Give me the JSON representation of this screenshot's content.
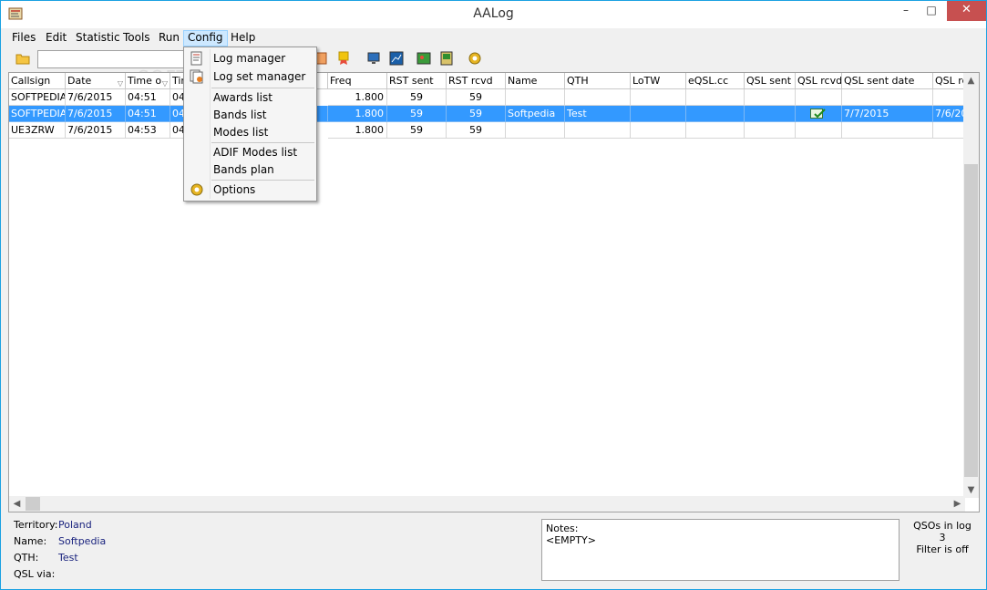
{
  "window": {
    "title": "AALog",
    "minimize": "–",
    "maximize": "□",
    "close": "✕"
  },
  "menu": [
    {
      "label": "Files",
      "key": "files"
    },
    {
      "label": "Edit",
      "key": "edit"
    },
    {
      "label": "Statistic",
      "key": "statistic"
    },
    {
      "label": "Tools",
      "key": "tools"
    },
    {
      "label": "Run",
      "key": "run"
    },
    {
      "label": "Config",
      "key": "config",
      "active": true
    },
    {
      "label": "Help",
      "key": "help"
    }
  ],
  "search": {
    "value": "",
    "placeholder": ""
  },
  "config_menu": {
    "items": [
      {
        "label": "Log manager",
        "icon": "log-manager-icon"
      },
      {
        "label": "Log set manager",
        "icon": "log-set-manager-icon"
      },
      {
        "label": "Awards list"
      },
      {
        "label": "Bands list"
      },
      {
        "label": "Modes list"
      },
      {
        "label": "ADIF Modes list"
      },
      {
        "label": "Bands plan"
      },
      {
        "label": "Options",
        "icon": "gear-icon"
      }
    ]
  },
  "grid": {
    "columns": [
      "Callsign",
      "Date",
      "Time o",
      "Tim",
      "Freq",
      "RST sent",
      "RST rcvd",
      "Name",
      "QTH",
      "LoTW",
      "eQSL.cc",
      "QSL sent",
      "QSL rcvd",
      "QSL sent date",
      "QSL rc"
    ],
    "rows": [
      {
        "callsign": "SOFTPEDIA",
        "date": "7/6/2015",
        "time_on": "04:51",
        "time_off": "04",
        "freq": "1.800",
        "rst_sent": "59",
        "rst_rcvd": "59",
        "name": "",
        "qth": "",
        "lotw": "",
        "eqsl": "",
        "qsl_sent": "",
        "qsl_rcvd": "",
        "qsl_sent_date": "",
        "qsl_rcvd_date": "",
        "selected": false
      },
      {
        "callsign": "SOFTPEDIA",
        "date": "7/6/2015",
        "time_on": "04:51",
        "time_off": "04",
        "freq": "1.800",
        "rst_sent": "59",
        "rst_rcvd": "59",
        "name": "Softpedia",
        "qth": "Test",
        "lotw": "",
        "eqsl": "",
        "qsl_sent": "",
        "qsl_rcvd": "check-icon",
        "qsl_sent_date": "7/7/2015",
        "qsl_rcvd_date": "7/6/20",
        "selected": true
      },
      {
        "callsign": "UE3ZRW",
        "date": "7/6/2015",
        "time_on": "04:53",
        "time_off": "04",
        "freq": "1.800",
        "rst_sent": "59",
        "rst_rcvd": "59",
        "name": "",
        "qth": "",
        "lotw": "",
        "eqsl": "",
        "qsl_sent": "",
        "qsl_rcvd": "",
        "qsl_sent_date": "",
        "qsl_rcvd_date": "",
        "selected": false
      }
    ]
  },
  "status": {
    "territory_label": "Territory:",
    "territory": "Poland",
    "name_label": "Name:",
    "name": "Softpedia",
    "qth_label": "QTH:",
    "qth": "Test",
    "qsl_via_label": "QSL via:",
    "qsl_via": "",
    "notes_label": "Notes:",
    "notes": "<EMPTY>",
    "qsos_label": "QSOs in log",
    "qsos_count": "3",
    "filter": "Filter is off"
  },
  "watermark": "SOFTPEDIA"
}
